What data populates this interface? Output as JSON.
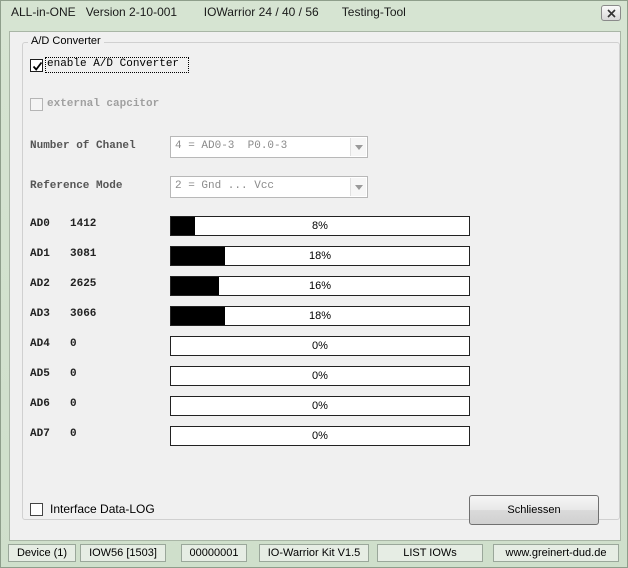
{
  "window": {
    "title": "ALL-in-ONE   Version 2-10-001        IOWarrior 24 / 40 / 56       Testing-Tool"
  },
  "group": {
    "legend": "A/D Converter"
  },
  "options": {
    "enable_ad": {
      "label": "enable A/D Converter",
      "checked": true
    },
    "external_cap": {
      "label": "external capcitor",
      "checked": false
    }
  },
  "channels": {
    "label": "Number of Chanel",
    "value": "4 = AD0-3  P0.0-3"
  },
  "reference": {
    "label": "Reference Mode",
    "value": "2 = Gnd ... Vcc"
  },
  "ad_rows": [
    {
      "name": "AD0",
      "value": "1412",
      "percent": "8%",
      "fraction": 0.08
    },
    {
      "name": "AD1",
      "value": "3081",
      "percent": "18%",
      "fraction": 0.18
    },
    {
      "name": "AD2",
      "value": "2625",
      "percent": "16%",
      "fraction": 0.16
    },
    {
      "name": "AD3",
      "value": "3066",
      "percent": "18%",
      "fraction": 0.18
    },
    {
      "name": "AD4",
      "value": "0",
      "percent": "0%",
      "fraction": 0
    },
    {
      "name": "AD5",
      "value": "0",
      "percent": "0%",
      "fraction": 0
    },
    {
      "name": "AD6",
      "value": "0",
      "percent": "0%",
      "fraction": 0
    },
    {
      "name": "AD7",
      "value": "0",
      "percent": "0%",
      "fraction": 0
    }
  ],
  "log": {
    "label": "Interface Data-LOG",
    "checked": false
  },
  "close_button": {
    "label": "Schliessen"
  },
  "statusbar": [
    "Device (1)",
    "IOW56 [1503]",
    "00000001",
    "IO-Warrior Kit V1.5",
    "LIST IOWs",
    "www.greinert-dud.de"
  ]
}
